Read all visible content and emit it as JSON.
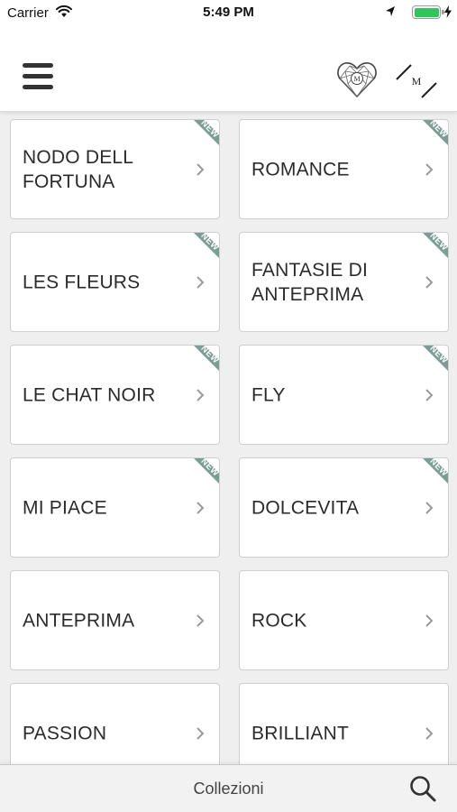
{
  "status_bar": {
    "carrier": "Carrier",
    "time": "5:49 PM",
    "icons": [
      "wifi-icon",
      "location-arrow-icon",
      "battery-icon",
      "charging-bolt-icon"
    ],
    "battery_color": "#2fc65b"
  },
  "header": {
    "menu_icon": "hamburger-menu-icon",
    "heart_icon": "diamond-heart-logo-icon",
    "heart_monogram": "M",
    "brand_icon": "brand-monogram-icon",
    "brand_monogram": "M"
  },
  "grid": {
    "ribbon_color": "#7a9e95",
    "items": [
      {
        "label": "NODO DELL FORTUNA",
        "badge": "NEW"
      },
      {
        "label": "ROMANCE",
        "badge": "NEW"
      },
      {
        "label": "LES FLEURS",
        "badge": "NEW"
      },
      {
        "label": "FANTASIE DI ANTEPRIMA",
        "badge": "NEW"
      },
      {
        "label": "LE CHAT NOIR",
        "badge": "NEW"
      },
      {
        "label": "FLY",
        "badge": "NEW"
      },
      {
        "label": "MI PIACE",
        "badge": "NEW"
      },
      {
        "label": "DOLCEVITA",
        "badge": "NEW"
      },
      {
        "label": "ANTEPRIMA",
        "badge": ""
      },
      {
        "label": "ROCK",
        "badge": ""
      },
      {
        "label": "PASSION",
        "badge": ""
      },
      {
        "label": "BRILLIANT",
        "badge": ""
      }
    ]
  },
  "bottom_bar": {
    "title": "Collezioni",
    "search_icon": "search-icon"
  }
}
